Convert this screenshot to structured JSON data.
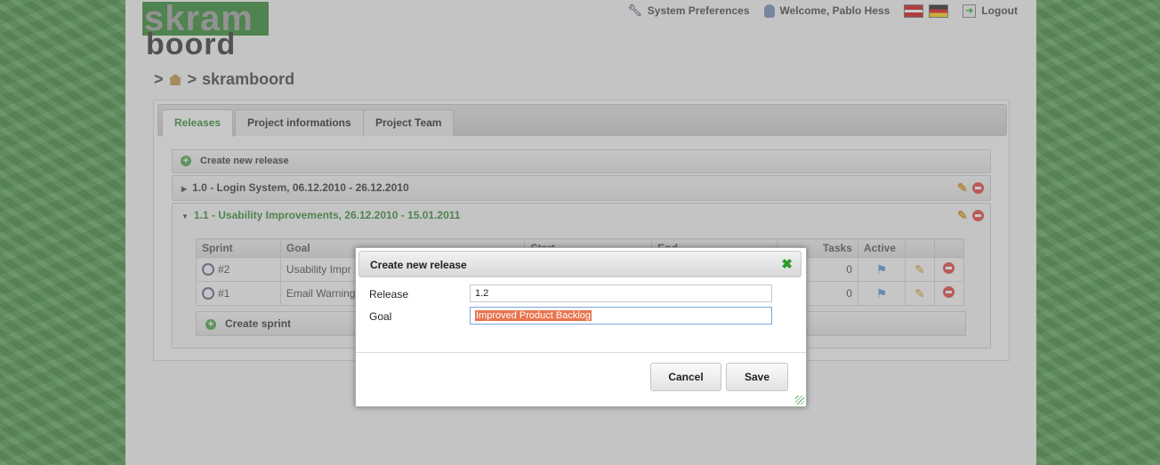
{
  "logo": {
    "top": "skram",
    "bottom": "boord"
  },
  "topnav": {
    "system_preferences": "System Preferences",
    "welcome": "Welcome, Pablo Hess",
    "logout": "Logout"
  },
  "breadcrumb": {
    "separator": ">",
    "project": "skramboord"
  },
  "tabs": [
    {
      "label": "Releases",
      "active": true
    },
    {
      "label": "Project informations",
      "active": false
    },
    {
      "label": "Project Team",
      "active": false
    }
  ],
  "releases": {
    "create_label": "Create new release",
    "items": [
      {
        "title": "1.0 - Login System, 06.12.2010 - 26.12.2010",
        "expanded": false
      },
      {
        "title": "1.1 - Usability Improvements, 26.12.2010 - 15.01.2011",
        "expanded": true
      }
    ]
  },
  "sprint_table": {
    "headers": [
      "Sprint",
      "Goal",
      "Start",
      "End",
      "Tasks",
      "Active"
    ],
    "rows": [
      {
        "sprint": "#2",
        "goal": "Usability Impr",
        "tasks": "0"
      },
      {
        "sprint": "#1",
        "goal": "Email Warning",
        "tasks": "0"
      }
    ],
    "create_label": "Create sprint"
  },
  "dialog": {
    "title": "Create new release",
    "release_label": "Release",
    "release_value": "1.2",
    "goal_label": "Goal",
    "goal_value": "Improved Product Backlog",
    "cancel_label": "Cancel",
    "save_label": "Save"
  },
  "colors": {
    "accent": "#1e7d1e",
    "selection": "#e8744e",
    "delete": "#dd3333"
  }
}
